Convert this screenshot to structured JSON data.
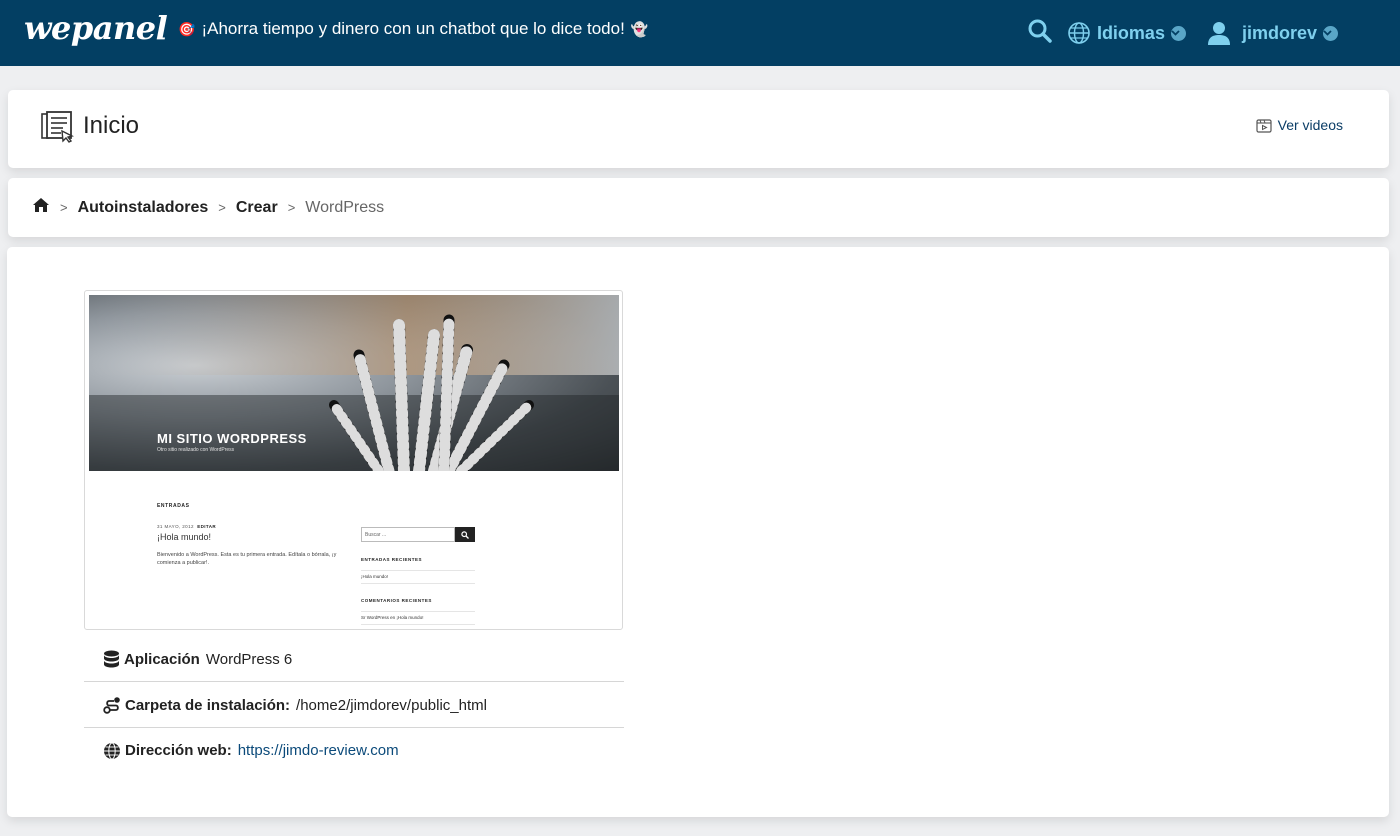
{
  "header": {
    "logo": "wepanel",
    "promo_text": "¡Ahorra tiempo y dinero con un chatbot que lo dice todo!",
    "promo_icon": "dart-emoji",
    "promo_trailing_icon": "ghost-emoji",
    "languages_label": "Idiomas",
    "username": "jimdorev",
    "bg_color": "#033f63",
    "accent_color": "#7fd0ee"
  },
  "page": {
    "title": "Inicio",
    "videos_label": "Ver videos"
  },
  "breadcrumb": {
    "items": [
      "Autoinstaladores",
      "Crear"
    ],
    "current": "WordPress",
    "separator": ">"
  },
  "preview": {
    "site_title": "MI SITIO WORDPRESS",
    "site_subtitle": "Otro sitio realizado con WordPress",
    "section_label": "ENTRADAS",
    "post_date": "31 MAYO, 2012",
    "post_edit": "EDITAR",
    "post_title": "¡Hola mundo!",
    "post_excerpt": "Bienvenido a WordPress. Esta es tu primera entrada. Edítala o bórrala, ¡y comienza a publicar!.",
    "search_placeholder": "Buscar ...",
    "recent_posts_title": "ENTRADAS RECIENTES",
    "recent_post_item": "¡Hola mundo!",
    "recent_comments_title": "COMENTARIOS RECIENTES",
    "recent_comment_item": "Sr WordPress en ¡Hola mundo!"
  },
  "info": {
    "app_label": "Aplicación",
    "app_value": "WordPress 6",
    "folder_label": "Carpeta de instalación:",
    "folder_value": "/home2/jimdorev/public_html",
    "url_label": "Dirección web:",
    "url_value": "https://jimdo-review.com"
  }
}
